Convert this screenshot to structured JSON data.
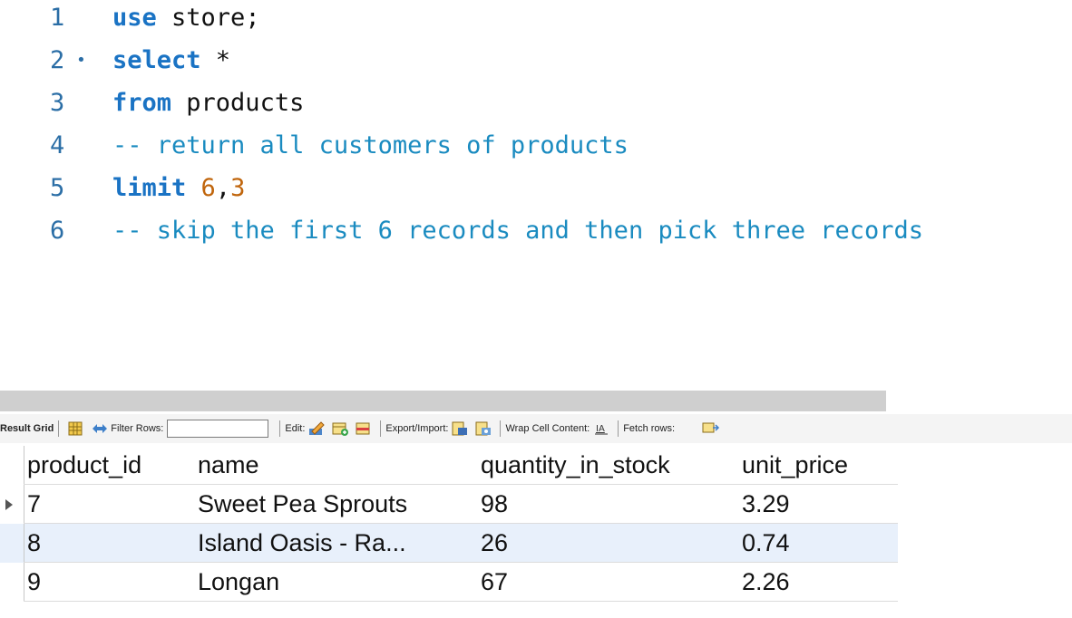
{
  "editor": {
    "lines": [
      {
        "num": "1",
        "parts": [
          {
            "t": "use",
            "c": "kw"
          },
          {
            "t": " store;",
            "c": ""
          }
        ]
      },
      {
        "num": "2",
        "fold": true,
        "parts": [
          {
            "t": "select",
            "c": "kw"
          },
          {
            "t": " *",
            "c": ""
          }
        ]
      },
      {
        "num": "3",
        "parts": [
          {
            "t": "from",
            "c": "kw"
          },
          {
            "t": " products",
            "c": ""
          }
        ]
      },
      {
        "num": "4",
        "parts": [
          {
            "t": "-- return all customers of products",
            "c": "cmt"
          }
        ]
      },
      {
        "num": "5",
        "parts": [
          {
            "t": "limit",
            "c": "kw"
          },
          {
            "t": " ",
            "c": ""
          },
          {
            "t": "6",
            "c": "num"
          },
          {
            "t": ",",
            "c": ""
          },
          {
            "t": "3",
            "c": "num"
          }
        ]
      },
      {
        "num": "6",
        "parts": [
          {
            "t": "-- skip the first 6 records and then pick three records",
            "c": "cmt"
          }
        ]
      }
    ]
  },
  "toolbar": {
    "result_grid": "Result Grid",
    "filter_rows": "Filter Rows:",
    "filter_value": "",
    "edit": "Edit:",
    "export_import": "Export/Import:",
    "wrap_cell": "Wrap Cell Content:",
    "fetch_rows": "Fetch rows:"
  },
  "grid": {
    "columns": [
      "product_id",
      "name",
      "quantity_in_stock",
      "unit_price"
    ],
    "rows": [
      [
        "7",
        "Sweet Pea Sprouts",
        "98",
        "3.29"
      ],
      [
        "8",
        "Island Oasis - Ra...",
        "26",
        "0.74"
      ],
      [
        "9",
        "Longan",
        "67",
        "2.26"
      ]
    ]
  },
  "icons": {
    "fold_marker": "dot-icon",
    "grid_view": "grid-view-icon",
    "filter_toggle": "refresh-arrows-icon",
    "edit_pencil": "pencil-edit-icon",
    "add_row": "add-row-icon",
    "delete_row": "delete-row-icon",
    "export": "export-icon",
    "import": "import-icon",
    "wrap": "wrap-text-icon",
    "fetch": "fetch-rows-icon"
  }
}
